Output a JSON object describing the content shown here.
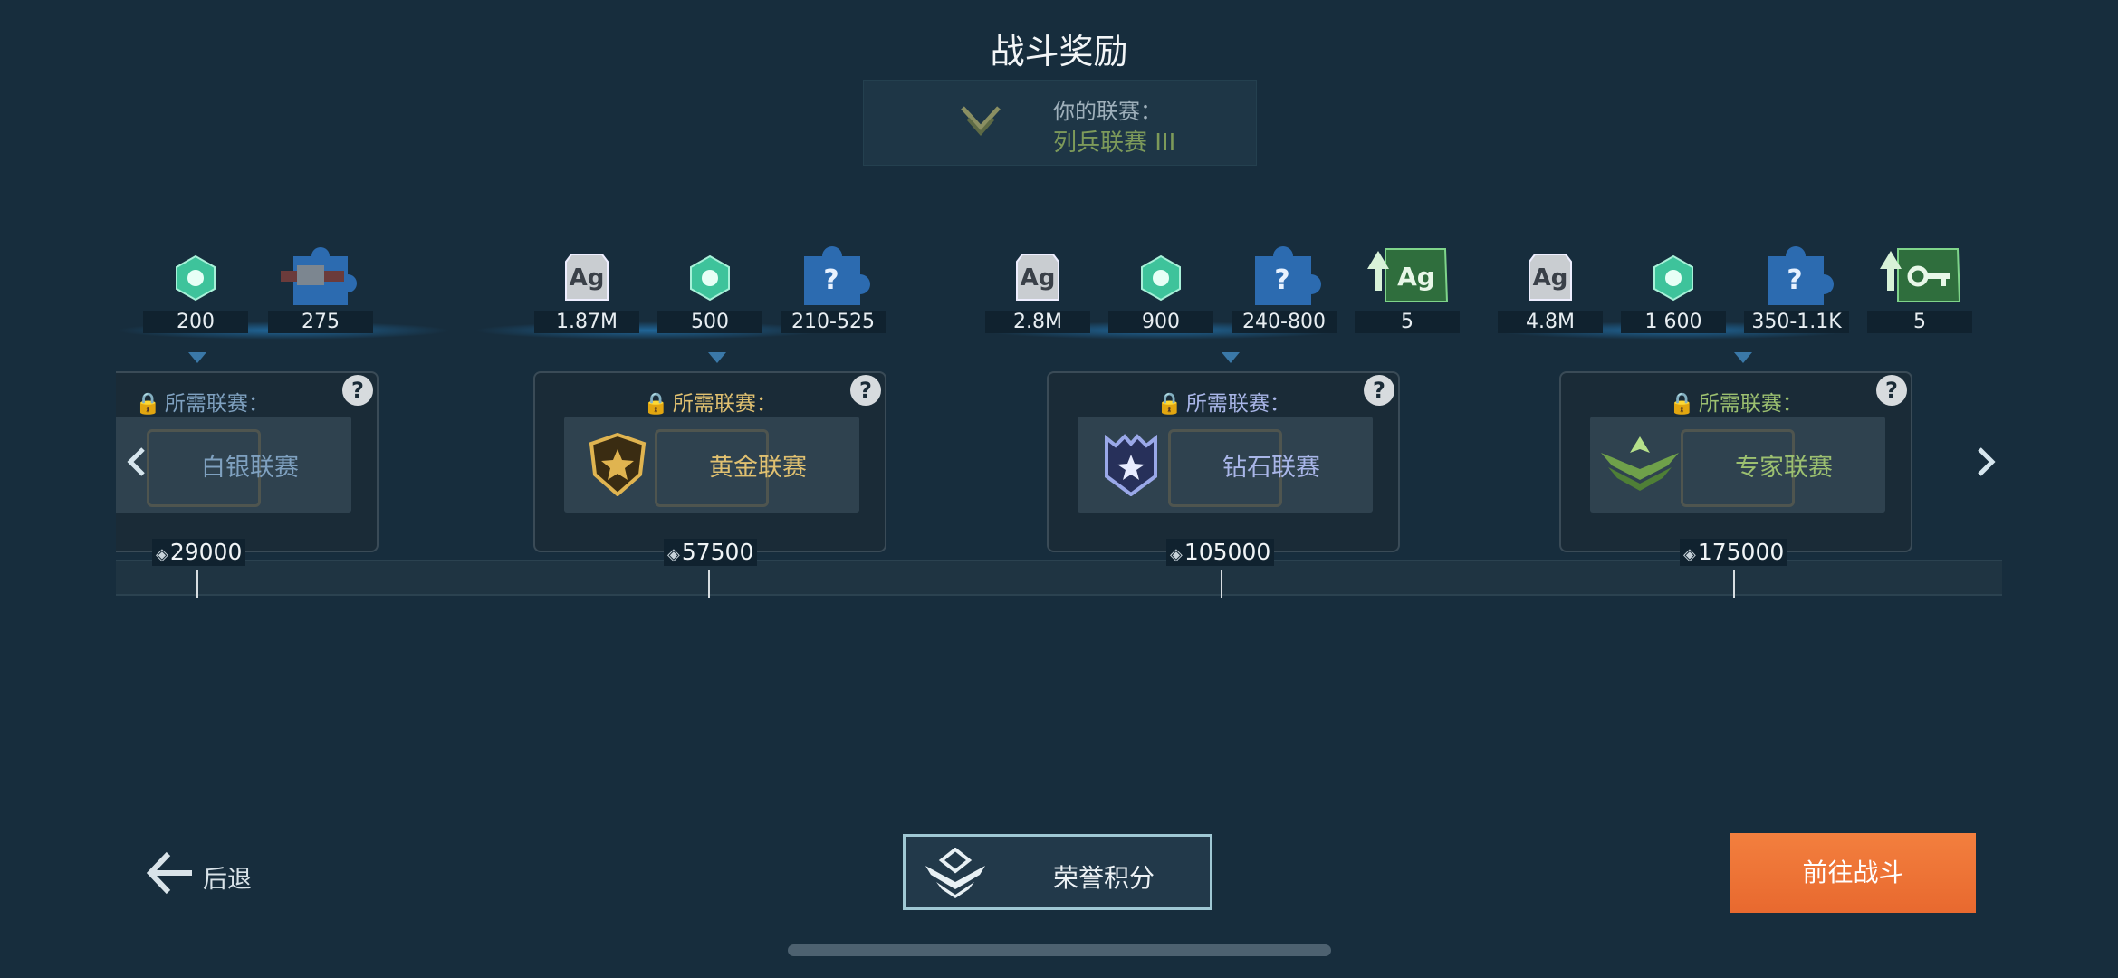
{
  "header": {
    "title": "战斗奖励"
  },
  "your_league": {
    "label": "你的联赛：",
    "value": "列兵联赛 III"
  },
  "rewards": {
    "g1": [
      "200",
      "275"
    ],
    "g2": [
      "1.87M",
      "500",
      "210-525"
    ],
    "g3": [
      "2.8M",
      "900",
      "240-800",
      "5"
    ],
    "g4": [
      "4.8M",
      "1 600",
      "350-1.1K",
      "5"
    ]
  },
  "icons": {
    "silver": "Ag",
    "unknown": "?"
  },
  "chests": [
    {
      "required_label": "所需联赛：",
      "league": "白银联赛",
      "score": "29000",
      "color": "#7fa1c0"
    },
    {
      "required_label": "所需联赛：",
      "league": "黄金联赛",
      "score": "57500",
      "color": "#e0c070"
    },
    {
      "required_label": "所需联赛：",
      "league": "钻石联赛",
      "score": "105000",
      "color": "#a9b6e8"
    },
    {
      "required_label": "所需联赛：",
      "league": "专家联赛",
      "score": "175000",
      "color": "#9cc070"
    }
  ],
  "buttons": {
    "back": "后退",
    "honor_points": "荣誉积分",
    "go_battle": "前往战斗"
  },
  "colors": {
    "accent_orange": "#ef7332",
    "background": "#172d3d",
    "gold": "#e0c070",
    "green_league": "#7d9a5a"
  }
}
